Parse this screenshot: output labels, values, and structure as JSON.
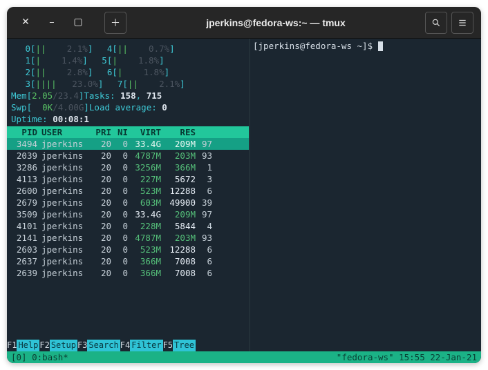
{
  "window": {
    "title": "jperkins@fedora-ws:~ — tmux"
  },
  "cpu_meters": {
    "left": [
      {
        "n": "0",
        "bars": "||",
        "pct": "2.1%"
      },
      {
        "n": "1",
        "bars": "|",
        "pct": "1.4%"
      },
      {
        "n": "2",
        "bars": "||",
        "pct": "2.8%"
      },
      {
        "n": "3",
        "bars": "||||",
        "pct": "23.0%"
      }
    ],
    "right": [
      {
        "n": "4",
        "bars": "||",
        "pct": "0.7%"
      },
      {
        "n": "5",
        "bars": "|",
        "pct": "1.8%"
      },
      {
        "n": "6",
        "bars": "|",
        "pct": "1.8%"
      },
      {
        "n": "7",
        "bars": "||",
        "pct": "2.1%"
      }
    ]
  },
  "mem": {
    "label": "Mem",
    "used": "2.05",
    "total": "/23.4",
    "close": "]"
  },
  "swp": {
    "label": "Swp",
    "used": "0K",
    "total": "/4.00G",
    "close": "]"
  },
  "tasks": {
    "label": "Tasks: ",
    "v1": "158",
    "sep": ", ",
    "v2": "715"
  },
  "load": {
    "label": "Load average: ",
    "val": "0"
  },
  "uptime": {
    "label": "Uptime: ",
    "val": "00:08:1"
  },
  "header": {
    "pid": "PID",
    "user": "USER",
    "pri": "PRI",
    "ni": "NI",
    "virt": "VIRT",
    "res": "RES"
  },
  "rows": [
    {
      "pid": "3494",
      "user": "jperkins",
      "pri": "20",
      "ni": "0",
      "virt": "33.4G",
      "res": "209M",
      "ext": "97",
      "sel": true,
      "vg": false
    },
    {
      "pid": "2039",
      "user": "jperkins",
      "pri": "20",
      "ni": "0",
      "virt": "4787M",
      "res": "203M",
      "ext": "93",
      "vg": true,
      "rg": true
    },
    {
      "pid": "3286",
      "user": "jperkins",
      "pri": "20",
      "ni": "0",
      "virt": "3256M",
      "res": "366M",
      "ext": "1",
      "vg": true,
      "rg": true
    },
    {
      "pid": "4113",
      "user": "jperkins",
      "pri": "20",
      "ni": "0",
      "virt": "227M",
      "res": "5672",
      "ext": "3",
      "vg": true
    },
    {
      "pid": "2600",
      "user": "jperkins",
      "pri": "20",
      "ni": "0",
      "virt": "523M",
      "res": "12288",
      "ext": "6",
      "vg": true
    },
    {
      "pid": "2679",
      "user": "jperkins",
      "pri": "20",
      "ni": "0",
      "virt": "603M",
      "res": "49900",
      "ext": "39",
      "vg": true
    },
    {
      "pid": "3509",
      "user": "jperkins",
      "pri": "20",
      "ni": "0",
      "virt": "33.4G",
      "res": "209M",
      "ext": "97",
      "rg": true
    },
    {
      "pid": "4101",
      "user": "jperkins",
      "pri": "20",
      "ni": "0",
      "virt": "228M",
      "res": "5844",
      "ext": "4",
      "vg": true
    },
    {
      "pid": "2141",
      "user": "jperkins",
      "pri": "20",
      "ni": "0",
      "virt": "4787M",
      "res": "203M",
      "ext": "93",
      "vg": true,
      "rg": true
    },
    {
      "pid": "2603",
      "user": "jperkins",
      "pri": "20",
      "ni": "0",
      "virt": "523M",
      "res": "12288",
      "ext": "6",
      "vg": true
    },
    {
      "pid": "2637",
      "user": "jperkins",
      "pri": "20",
      "ni": "0",
      "virt": "366M",
      "res": "7008",
      "ext": "6",
      "vg": true
    },
    {
      "pid": "2639",
      "user": "jperkins",
      "pri": "20",
      "ni": "0",
      "virt": "366M",
      "res": "7008",
      "ext": "6",
      "vg": true
    }
  ],
  "fkeys": [
    {
      "k": "F1",
      "l": "Help"
    },
    {
      "k": "F2",
      "l": "Setup"
    },
    {
      "k": "F3",
      "l": "Search"
    },
    {
      "k": "F4",
      "l": "Filter"
    },
    {
      "k": "F5",
      "l": "Tree"
    }
  ],
  "status": {
    "left": "[0] 0:bash*",
    "right": "\"fedora-ws\" 15:55 22-Jan-21"
  },
  "prompt": "[jperkins@fedora-ws ~]$ "
}
